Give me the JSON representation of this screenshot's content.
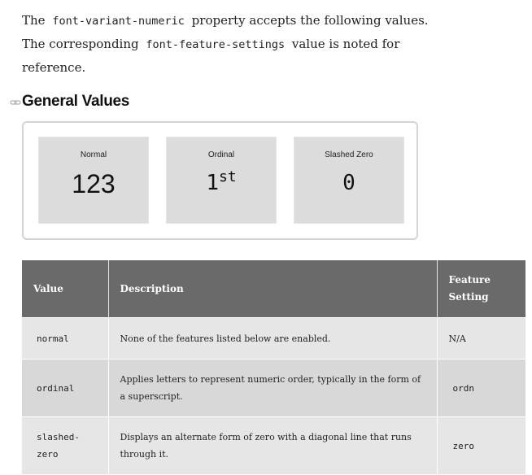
{
  "intro": {
    "part1": "The",
    "code1": "font-variant-numeric",
    "part2": "property accepts the following values.",
    "part3": "The corresponding",
    "code2": "font-feature-settings",
    "part4": "value is noted for reference."
  },
  "section": {
    "title": "General Values"
  },
  "demo": {
    "cards": [
      {
        "caption": "Normal",
        "value": "123"
      },
      {
        "caption": "Ordinal",
        "value_base": "1",
        "value_sup": "st"
      },
      {
        "caption": "Slashed Zero",
        "value": "0"
      }
    ]
  },
  "table": {
    "headers": [
      "Value",
      "Description",
      "Feature Setting"
    ],
    "rows": [
      {
        "value": "normal",
        "description": "None of the features listed below are enabled.",
        "setting": "N/A"
      },
      {
        "value": "ordinal",
        "description": "Applies letters to represent numeric order, typically in the form of a superscript.",
        "setting": "ordn"
      },
      {
        "value": "slashed-zero",
        "description": "Displays an alternate form of zero with a diagonal line that runs through it.",
        "setting": "zero"
      }
    ]
  }
}
